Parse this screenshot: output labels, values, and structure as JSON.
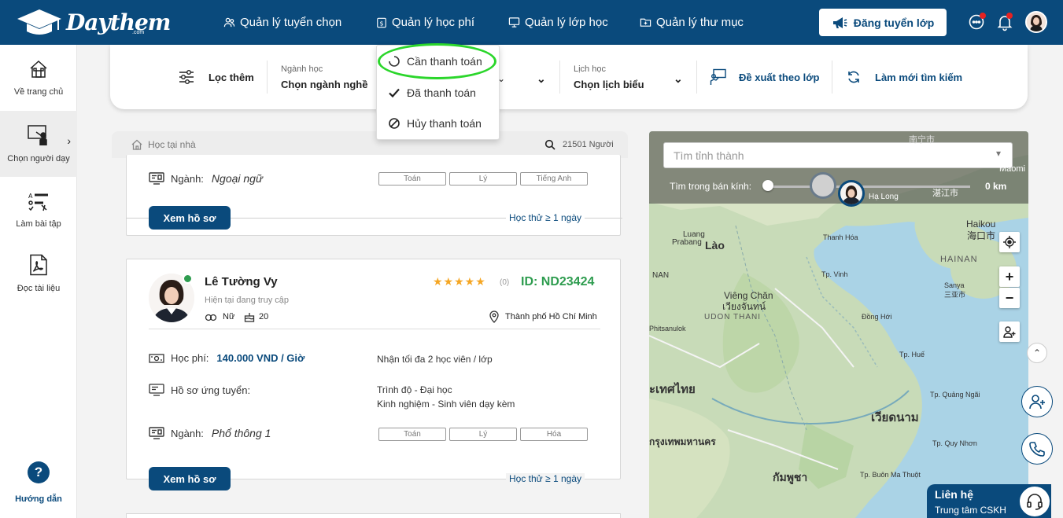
{
  "brand": {
    "name": "Daythem",
    "suffix": ".com"
  },
  "nav": {
    "recruit": "Quản lý tuyển chọn",
    "fees": "Quản lý học phí",
    "classes": "Quản lý lớp học",
    "folders": "Quản lý thư mục",
    "post_button": "Đăng tuyển lớp"
  },
  "sidebar": {
    "items": [
      {
        "label": "Về trang chủ",
        "icon": "home-icon"
      },
      {
        "label": "Chọn người dạy",
        "icon": "teacher-icon"
      },
      {
        "label": "Làm bài tập",
        "icon": "exercise-icon"
      },
      {
        "label": "Đọc tài liệu",
        "icon": "pdf-icon"
      }
    ],
    "help": "Hướng dẫn"
  },
  "filters": {
    "more": "Lọc thêm",
    "subject_label": "Ngành học",
    "subject_value": "Chọn ngành nghề",
    "schedule_label": "Lịch học",
    "schedule_value": "Chọn lịch biểu",
    "suggest": "Đề xuất theo lớp",
    "refresh": "Làm mới tìm kiếm"
  },
  "fee_menu": {
    "items": [
      "Cần thanh toán",
      "Đã thanh toán",
      "Hủy thanh toán"
    ]
  },
  "list": {
    "location": "Học tại nhà",
    "count": "21501 Người"
  },
  "card1": {
    "subject_label": "Ngành:",
    "subject_value": "Ngoại ngữ",
    "tags": [
      "Toán",
      "Lý",
      "Tiếng Anh"
    ],
    "view_button": "Xem hồ sơ",
    "trial": "Học thử ≥ 1 ngày"
  },
  "card2": {
    "name": "Lê Tường Vy",
    "status": "Hiện tại đang truy cập",
    "gender": "Nữ",
    "age": "20",
    "rating_count": "(0)",
    "rating": 5,
    "id": "ID: ND23424",
    "city": "Thành phố Hồ Chí Minh",
    "fee_label": "Học phí:",
    "fee_value": "140.000 VND / Giờ",
    "capacity": "Nhận tối đa 2 học viên / lớp",
    "profile_label": "Hồ sơ ứng tuyển:",
    "level": "Trình độ - Đại học",
    "experience": "Kinh nghiệm - Sinh viên dạy kèm",
    "subject_label": "Ngành:",
    "subject_value": "Phổ thông 1",
    "tags": [
      "Toán",
      "Lý",
      "Hóa"
    ],
    "view_button": "Xem hồ sơ",
    "trial": "Học thử ≥ 1 ngày"
  },
  "map": {
    "search_placeholder": "Tìm tỉnh thành",
    "radius_label": "Tìm trong bán kính:",
    "radius_value": "0 km",
    "labels": {
      "laos": "Lào",
      "luang": "Luang",
      "prabang": "Prabang",
      "thanhhoa": "Thanh Hóa",
      "vinh": "Tp. Vinh",
      "viengchan": "Viêng Chăn",
      "viengchan_th": "เวียงจันทน์",
      "udon": "UDON THANI",
      "donghoi": "Đồng Hới",
      "hue": "Tp. Huế",
      "haikou": "Haikou",
      "haikou_cn": "海口市",
      "hainan": "HAINAN",
      "sanya": "Sanya",
      "sanya_cn": "三亚市",
      "thai": "ะเทศไทย",
      "vietnam": "เวียดนาม",
      "bangkok": "กรุงเทพมหานคร",
      "cambodia": "กัมพูชา",
      "phitsanulok": "Phitsanulok",
      "nan": "NAN",
      "halong": "Hạ Long",
      "zhanjiang": "湛江市",
      "nanning": "南宁市",
      "quangngai": "Tp. Quảng Ngãi",
      "quynhon": "Tp. Quy Nhơn",
      "buonmathuot": "Tp. Buôn Ma Thuột",
      "maoming": "Maomi"
    }
  },
  "support": {
    "title": "Liên hệ",
    "subtitle": "Trung tâm CSKH"
  },
  "colors": {
    "primary": "#0a4a7c",
    "accent_green": "#2e9c4f",
    "highlight": "#2bd62b",
    "star": "#f5a623"
  }
}
